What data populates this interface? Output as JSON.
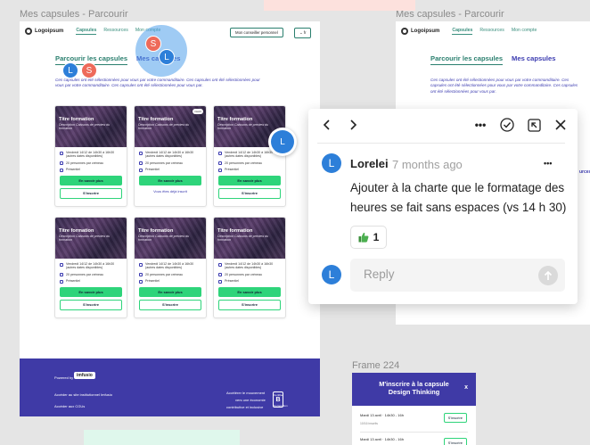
{
  "frames": {
    "left_label": "Mes capsules - Parcourir",
    "right_label": "Mes capsules - Parcourir",
    "modal_label": "Frame 224"
  },
  "header": {
    "logo": "Logoipsum",
    "nav": [
      "Capsules",
      "Ressources",
      "Mon compte"
    ],
    "contact_button": "Mon conseiller personnel",
    "lang": "fr"
  },
  "tabs": {
    "browse": "Parcourir les capsules",
    "mine": "Mes capsules"
  },
  "description": "Ces capsules ont été sélectionnées pour vous par votre commanditaire. Ces capsules ont été sélectionnées pour vous par votre commanditaire. Ces capsules ont été sélectionnées pour vous par.",
  "cards": [
    {
      "title": "Titre formation",
      "subtitle": "Description Caissons de preview du formation",
      "badge": "",
      "date": "Vendredi 14/12 de 14h30 à 16h30 (autres dates disponibles)",
      "seats": "20 personnes par créneau",
      "mode": "Présentiel",
      "primary": "En savoir plus",
      "secondary": "S'inscrire"
    },
    {
      "title": "Titre formation",
      "subtitle": "Description Caissons de preview du formation",
      "badge": "inscrit",
      "date": "Vendredi 14/12 de 14h30 à 16h30 (autres dates disponibles)",
      "seats": "20 personnes par créneau",
      "mode": "Présentiel",
      "primary": "En savoir plus",
      "secondary": "",
      "note": "Vous êtes déjà inscrit"
    },
    {
      "title": "Titre formation",
      "subtitle": "Description Caissons de preview du formation",
      "badge": "",
      "date": "Vendredi 14/12 de 14h30 à 16h30 (autres dates disponibles)",
      "seats": "20 personnes par créneau",
      "mode": "Présentiel",
      "primary": "En savoir plus",
      "secondary": "S'inscrire"
    },
    {
      "title": "Titre formation",
      "subtitle": "Description Caissons de preview du formation",
      "badge": "",
      "date": "Vendredi 14/12 de 14h30 à 16h30 (autres dates disponibles)",
      "seats": "20 personnes par créneau",
      "mode": "Présentiel",
      "primary": "En savoir plus",
      "secondary": "S'inscrire"
    },
    {
      "title": "Titre formation",
      "subtitle": "Description Caissons de preview du formation",
      "badge": "",
      "date": "Vendredi 14/12 de 14h30 à 16h30 (autres dates disponibles)",
      "seats": "20 personnes par créneau",
      "mode": "Présentiel",
      "primary": "En savoir plus",
      "secondary": "S'inscrire"
    },
    {
      "title": "Titre formation",
      "subtitle": "Description Caissons de preview du formation",
      "badge": "",
      "date": "Vendredi 14/12 de 14h30 à 16h30 (autres dates disponibles)",
      "seats": "20 personnes par créneau",
      "mode": "Présentiel",
      "primary": "En savoir plus",
      "secondary": "S'inscrire"
    }
  ],
  "footer": {
    "powered_by": "Powered by",
    "brand": "imfusio",
    "link1": "Accéder au site institutionnel Imfusio",
    "link2": "Accéder aux CGUs",
    "tagline": [
      "Accélérer le mouvement",
      "vers une économie",
      "contributive et inclusive"
    ],
    "certified": "Certified",
    "certified_mark": "B",
    "certified_sub": "Corporation"
  },
  "collaborators": {
    "l": "L",
    "s": "S"
  },
  "comment": {
    "author": "Lorelei",
    "author_initial": "L",
    "time": "7 months ago",
    "text": "Ajouter à la charte que le formatage des heures se fait sans espaces (vs 14 h 30)",
    "reaction_count": "1",
    "reply_placeholder": "Reply",
    "more_icon": "•••",
    "toolbar_more_icon": "•••"
  },
  "modal": {
    "title": "M'inscrire à la capsule Design Thinking",
    "close": "x",
    "slot1": "Mardi 13 avril · 14h30 - 16h",
    "slot1_sub": "10/16 inscrits",
    "slot2": "Mardi 13 avril · 14h30 - 16h",
    "slot_button": "S'inscrire"
  },
  "right_frame": {
    "partial_text": "urces"
  },
  "colors": {
    "accent_green": "#2ed47a",
    "brand_purple": "#3f3aa6",
    "teal": "#2a7f6e",
    "avatar_blue": "#2d7fd9",
    "avatar_red": "#ee6a5a"
  }
}
